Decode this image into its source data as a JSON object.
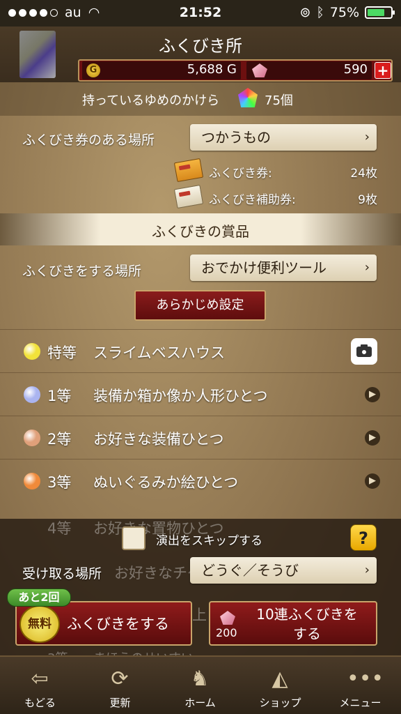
{
  "status_bar": {
    "carrier": "au",
    "time": "21:52",
    "battery_percent": "75%",
    "battery_level": 0.75
  },
  "header": {
    "title": "ふくびき所",
    "gold": "5,688 G",
    "gold_icon_letter": "G",
    "gems": "590",
    "plus_label": "+"
  },
  "fragments": {
    "label": "持っているゆめのかけら",
    "count": "75個"
  },
  "ticket_section": {
    "location_label": "ふくびき券のある場所",
    "location_value": "つかうもの",
    "tickets_label": "ふくびき券:",
    "tickets_count": "24枚",
    "assist_label": "ふくびき補助券:",
    "assist_count": "9枚"
  },
  "prizes": {
    "header": "ふくびきの賞品",
    "place_label": "ふくびきをする場所",
    "place_value": "おでかけ便利ツール",
    "preset_label": "あらかじめ設定",
    "items": [
      {
        "rank": "特等",
        "name": "スライムベスハウス",
        "orb_color": "#f2e23a"
      },
      {
        "rank": "1等",
        "name": "装備か箱か像か人形ひとつ",
        "orb_color": "#aab4f0"
      },
      {
        "rank": "2等",
        "name": "お好きな装備ひとつ",
        "orb_color": "#e0a07a"
      },
      {
        "rank": "3等",
        "name": "ぬいぐるみか絵ひとつ",
        "orb_color": "#f08a3a"
      }
    ],
    "partial_rank_4": "4等",
    "partial_name_4": "お好きな置物ひとつ",
    "partial_name_5": "お好きなチケ",
    "partial_name_6": "上",
    "partial_rank_7": "3等",
    "partial_name_7": "まほうのせいすい"
  },
  "controls": {
    "skip_label": "演出をスキップする",
    "help_label": "?",
    "receive_label": "受け取る場所",
    "receive_value": "どうぐ／そうび",
    "remaining_badge": "あと2回",
    "free_badge": "無料",
    "draw_label": "ふくびきをする",
    "draw10_label_line1": "10連ふくびきを",
    "draw10_label_line2": "する",
    "draw10_cost": "200"
  },
  "nav": [
    {
      "label": "もどる",
      "icon": "back-arrow-icon",
      "glyph": "⇦"
    },
    {
      "label": "更新",
      "icon": "refresh-icon",
      "glyph": "⟳"
    },
    {
      "label": "ホーム",
      "icon": "home-dragon-icon",
      "glyph": "♞"
    },
    {
      "label": "ショップ",
      "icon": "shop-slime-icon",
      "glyph": "◭"
    },
    {
      "label": "メニュー",
      "icon": "menu-dots-icon",
      "glyph": "•••"
    }
  ],
  "colors": {
    "accent_red": "#8f1b1b",
    "gold_border": "#c9a46a",
    "panel_bg": "#8f7550"
  }
}
